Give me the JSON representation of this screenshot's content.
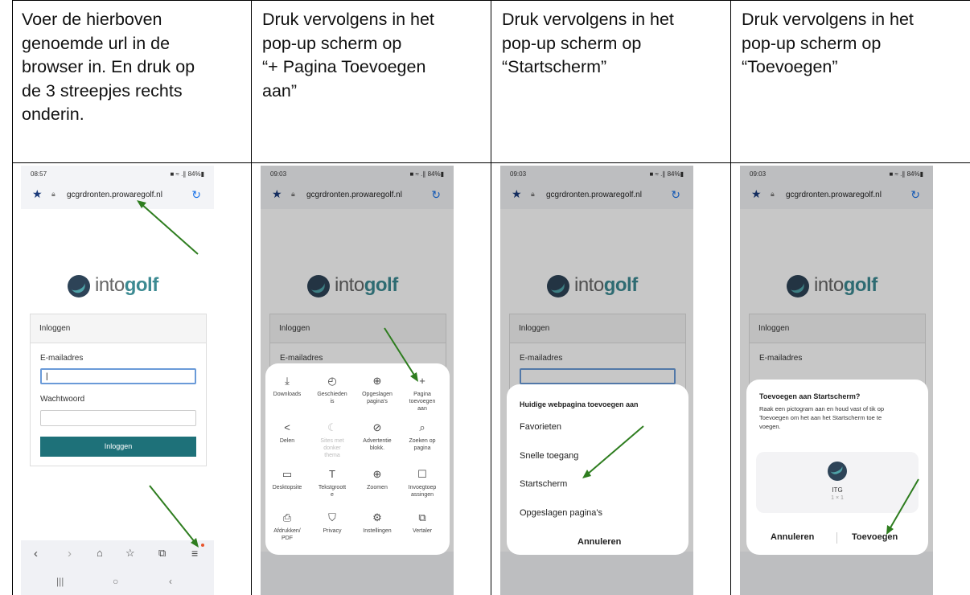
{
  "instructions": [
    "Voer de hierboven\ngenoemde url in de\nbrowser in. En druk op\nde 3 streepjes rechts\nonderin.",
    "Druk vervolgens in het\npop-up scherm op\n “+ Pagina Toevoegen\naan”",
    "Druk vervolgens in het\npop-up scherm op\n“Startscherm”",
    "Druk vervolgens in het\npop-up scherm op\n“Toevoegen”"
  ],
  "screens": [
    {
      "time": "08:57",
      "status_right": "■ ≈ .∥ 84%▮"
    },
    {
      "time": "09:03",
      "status_right": "■ ≈ .∥ 84%▮"
    },
    {
      "time": "09:03",
      "status_right": "■ ≈ .∥ 84%▮"
    },
    {
      "time": "09:03",
      "status_right": "■ ≈ .∥ 84%▮"
    }
  ],
  "browser": {
    "url": "gcgrdronten.prowaregolf.nl",
    "logo_light": "into",
    "logo_bold": "golf"
  },
  "login": {
    "header": "Inloggen",
    "email_label": "E-mailadres",
    "password_label": "Wachtwoord",
    "button": "Inloggen"
  },
  "menu_items": [
    {
      "label": "Downloads",
      "icon": "⤓"
    },
    {
      "label": "Geschieden\nis",
      "icon": "◴"
    },
    {
      "label": "Opgeslagen\npagina's",
      "icon": "⊕"
    },
    {
      "label": "Pagina\ntoevoegen\naan",
      "icon": "+"
    },
    {
      "label": "Delen",
      "icon": "<"
    },
    {
      "label": "Sites met\ndonker\nthema",
      "icon": "☾"
    },
    {
      "label": "Advertentie\nblokk.",
      "icon": "⊘"
    },
    {
      "label": "Zoeken op\npagina",
      "icon": "⌕"
    },
    {
      "label": "Desktopsite",
      "icon": "▭"
    },
    {
      "label": "Tekstgroott\ne",
      "icon": "T"
    },
    {
      "label": "Zoomen",
      "icon": "⊕"
    },
    {
      "label": "Invoegtoep\nassingen",
      "icon": "☐"
    },
    {
      "label": "Afdrukken/\nPDF",
      "icon": "⎙"
    },
    {
      "label": "Privacy",
      "icon": "⛉"
    },
    {
      "label": "Instellingen",
      "icon": "⚙"
    },
    {
      "label": "Vertaler",
      "icon": "⧉"
    }
  ],
  "add_sheet": {
    "title": "Huidige webpagina toevoegen aan",
    "options": [
      "Favorieten",
      "Snelle toegang",
      "Startscherm",
      "Opgeslagen pagina's"
    ],
    "cancel": "Annuleren"
  },
  "home_dialog": {
    "title": "Toevoegen aan Startscherm?",
    "body": "Raak een pictogram aan en houd vast of tik op\nToevoegen om het aan het Startscherm toe te\nvoegen.",
    "app_name": "ITG",
    "app_size": "1 × 1",
    "cancel": "Annuleren",
    "confirm": "Toevoegen"
  },
  "colors": {
    "arrow": "#2e7d1f",
    "login_button": "#1e7179",
    "logo_accent": "#3c8a92"
  }
}
